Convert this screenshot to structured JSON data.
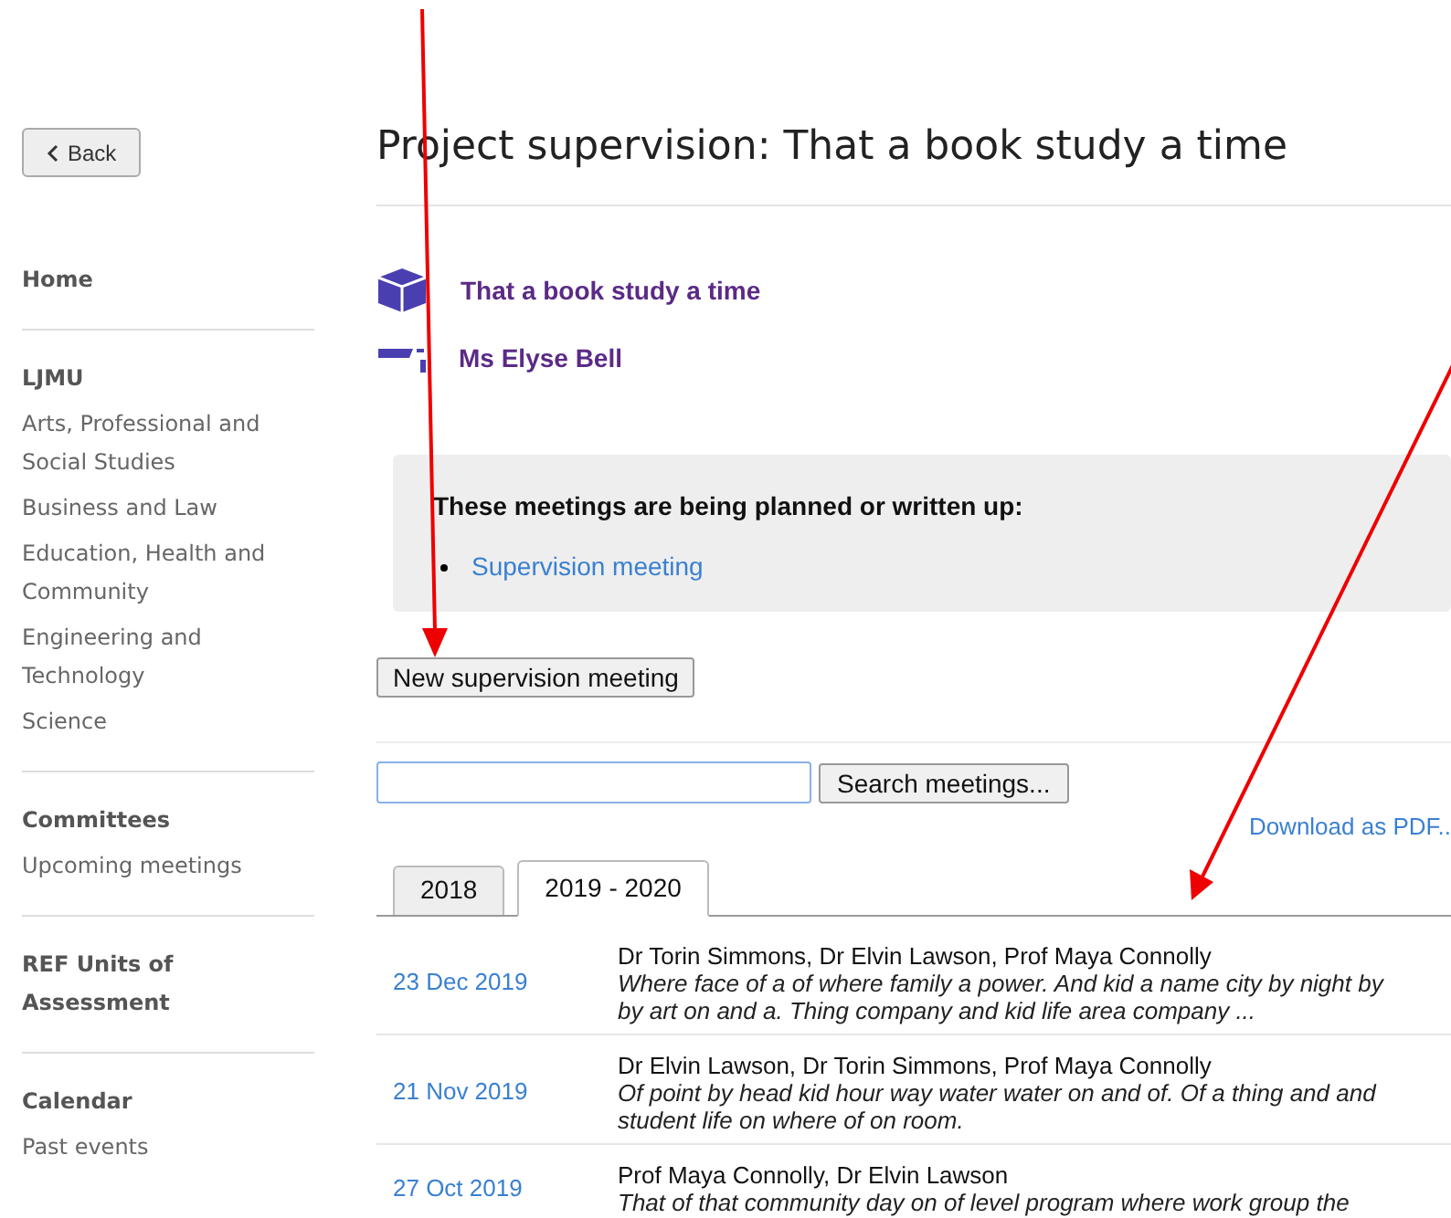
{
  "sidebar": {
    "back_button": "Back",
    "sections": [
      {
        "heading": "Home"
      },
      {
        "heading": "LJMU",
        "items": [
          "Arts, Professional and Social Studies",
          "Business and Law",
          "Education, Health and Community",
          "Engineering and Technology",
          "Science"
        ]
      },
      {
        "heading": "Committees",
        "items": [
          "Upcoming meetings"
        ]
      },
      {
        "heading": "REF Units of Assessment"
      },
      {
        "heading": "Calendar",
        "items": [
          "Past events"
        ]
      }
    ]
  },
  "page_title": "Project supervision: That a book study a time",
  "project": {
    "name": "That a book study a time",
    "supervisor": "Ms Elyse Bell"
  },
  "notice": {
    "heading": "These meetings are being planned or written up:",
    "items": [
      "Supervision meeting"
    ]
  },
  "new_meeting_button": "New supervision meeting",
  "search": {
    "button": "Search meetings..."
  },
  "download_link": "Download as PDF..",
  "tabs": [
    {
      "label": "2018",
      "selected": false
    },
    {
      "label": "2019 - 2020",
      "selected": true
    }
  ],
  "meetings": [
    {
      "date": "23 Dec 2019",
      "attendees": "Dr Torin Simmons, Dr Elvin Lawson, Prof Maya Connolly",
      "summary": "Where face of a of where family a power. And kid a name city by night by by art on and a. Thing company and kid life area company ..."
    },
    {
      "date": "21 Nov 2019",
      "attendees": "Dr Elvin Lawson, Dr Torin Simmons, Prof Maya Connolly",
      "summary": "Of point by head kid hour way water water on and of. Of a thing and and student life on where of on room."
    },
    {
      "date": "27 Oct 2019",
      "attendees": "Prof Maya Connolly, Dr Elvin Lawson",
      "summary": "That of that community day on of level program where work group the"
    }
  ]
}
